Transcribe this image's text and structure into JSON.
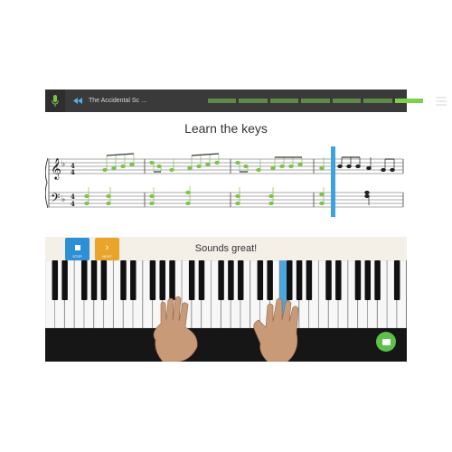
{
  "app": {
    "song_title": "The Accidental Sc …",
    "heading": "Learn the keys",
    "status_message": "Sounds great!",
    "progress_segments": 7,
    "progress_active_segment": 6
  },
  "controls": {
    "stop_label": "STOP",
    "next_label": "NEXT"
  },
  "icons": {
    "mic": "microphone-icon",
    "back": "rewind-icon",
    "menu": "hamburger-menu-icon",
    "stop": "stop-square-icon",
    "next": "chevron-right-icon",
    "chat": "chat-bubble-icon"
  },
  "colors": {
    "note_green": "#7cc24a",
    "playhead_blue": "#3aa3e0",
    "stop_blue": "#2d8fd6",
    "next_orange": "#e8a52a",
    "progress_active": "#7dd04b",
    "progress_inactive": "#5b8a49",
    "highlight_key": "#4aa8e0"
  }
}
